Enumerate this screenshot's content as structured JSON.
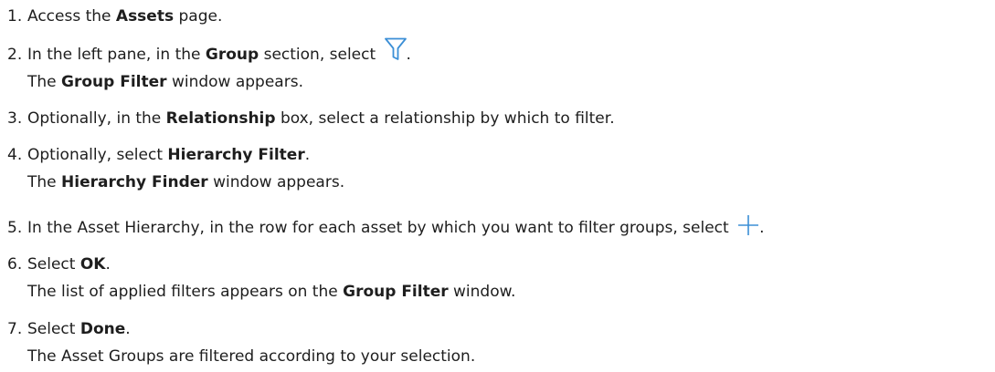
{
  "steps": [
    {
      "number": "1.",
      "parts": [
        {
          "t": "Access the ",
          "b": false
        },
        {
          "t": "Assets",
          "b": true
        },
        {
          "t": " page.",
          "b": false
        }
      ]
    },
    {
      "number": "2.",
      "parts": [
        {
          "t": "In the left pane, in the ",
          "b": false
        },
        {
          "t": "Group",
          "b": true
        },
        {
          "t": " section, select ",
          "b": false
        }
      ],
      "icon": "filter-icon",
      "after_icon": ".",
      "result": [
        {
          "t": "The ",
          "b": false
        },
        {
          "t": "Group Filter",
          "b": true
        },
        {
          "t": " window appears.",
          "b": false
        }
      ]
    },
    {
      "number": "3.",
      "parts": [
        {
          "t": "Optionally, in the ",
          "b": false
        },
        {
          "t": "Relationship",
          "b": true
        },
        {
          "t": " box, select a relationship by which to filter.",
          "b": false
        }
      ]
    },
    {
      "number": "4.",
      "parts": [
        {
          "t": "Optionally, select ",
          "b": false
        },
        {
          "t": "Hierarchy Filter",
          "b": true
        },
        {
          "t": ".",
          "b": false
        }
      ],
      "result": [
        {
          "t": "The ",
          "b": false
        },
        {
          "t": "Hierarchy Finder",
          "b": true
        },
        {
          "t": " window appears.",
          "b": false
        }
      ]
    },
    {
      "number": "5.",
      "parts": [
        {
          "t": "In the Asset Hierarchy, in the row for each asset by which you want to filter groups, select ",
          "b": false
        }
      ],
      "icon": "plus-icon",
      "after_icon": "."
    },
    {
      "number": "6.",
      "parts": [
        {
          "t": "Select ",
          "b": false
        },
        {
          "t": "OK",
          "b": true
        },
        {
          "t": ".",
          "b": false
        }
      ],
      "result": [
        {
          "t": "The list of applied filters appears on the ",
          "b": false
        },
        {
          "t": "Group Filter",
          "b": true
        },
        {
          "t": " window.",
          "b": false
        }
      ]
    },
    {
      "number": "7.",
      "parts": [
        {
          "t": "Select ",
          "b": false
        },
        {
          "t": "Done",
          "b": true
        },
        {
          "t": ".",
          "b": false
        }
      ],
      "result": [
        {
          "t": "The Asset Groups are filtered according to your selection.",
          "b": false
        }
      ]
    }
  ],
  "colors": {
    "text": "#1e1e1e",
    "icon": "#3b8fd6"
  }
}
